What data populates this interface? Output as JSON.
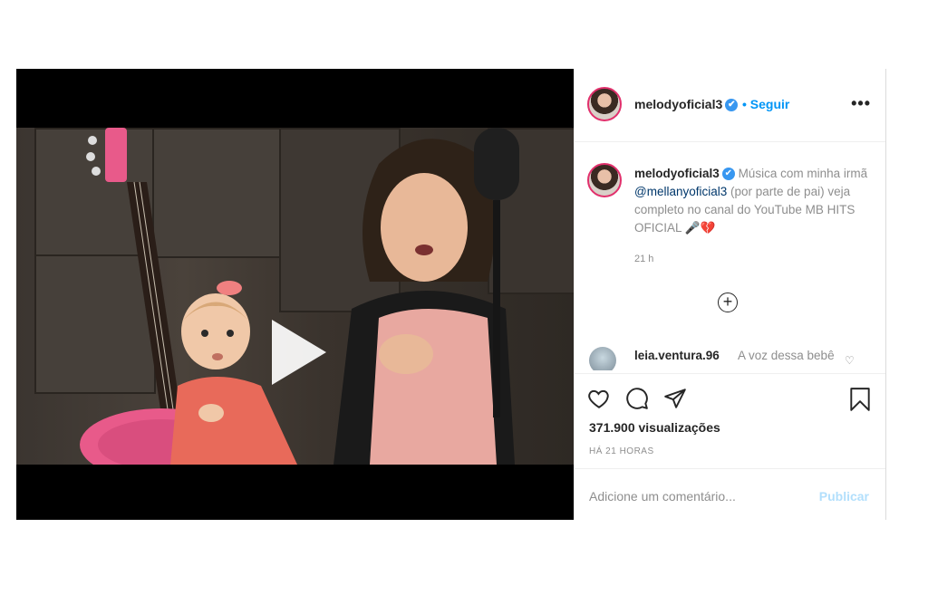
{
  "post": {
    "username": "melodyoficial3",
    "verified_mark": "✔",
    "follow_label": "• Seguir",
    "more_label": "•••",
    "caption": {
      "username": "melodyoficial3",
      "text_a": "Música com minha irmã",
      "mention": "@mellanyoficial3",
      "text_b": "(por parte de pai) veja completo no canal do YouTube MB HITS OFICIAL",
      "emoji": "🎤💔"
    },
    "caption_time": "21 h",
    "load_more_label": "+",
    "comment": {
      "username": "leia.ventura.96",
      "text": "A voz dessa bebê"
    },
    "views": "371.900 visualizações",
    "posted_ago": "HÁ 21 HORAS",
    "add_comment_placeholder": "Adicione um comentário...",
    "publish_label": "Publicar"
  },
  "icons": {
    "like": "heart-icon",
    "comment": "comment-icon",
    "share": "share-icon",
    "save": "bookmark-icon",
    "play": "play-icon",
    "more": "more-icon"
  },
  "colors": {
    "accent": "#0095f6",
    "verified": "#3897f0",
    "publish_disabled": "#b2dffc",
    "guitar": "#e85a8a"
  }
}
